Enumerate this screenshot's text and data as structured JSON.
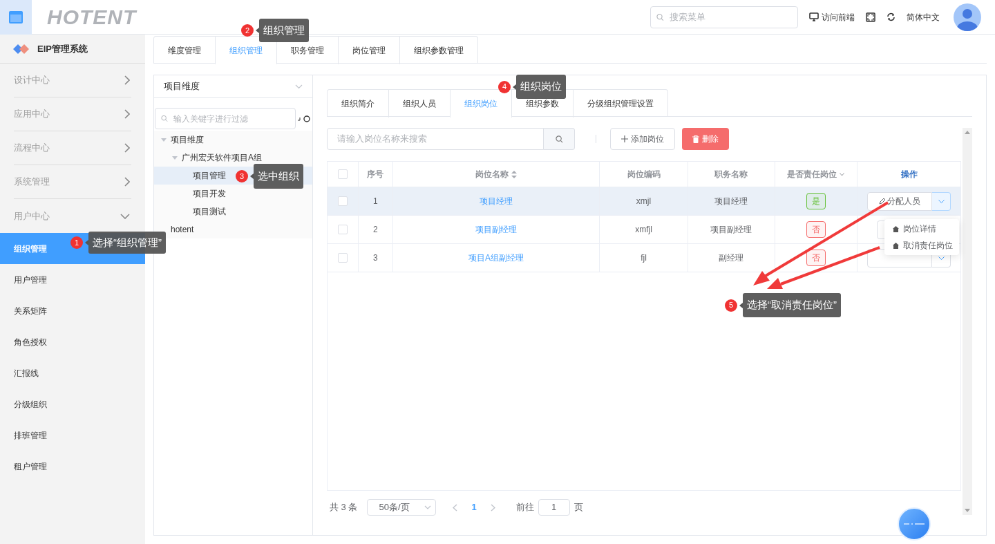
{
  "header": {
    "logo": "HOTENT",
    "search_placeholder": "搜索菜单",
    "visit_frontend": "访问前端",
    "language": "简体中文"
  },
  "sidebar": {
    "title": "EIP管理系统",
    "groups": [
      {
        "label": "设计中心",
        "expanded": false
      },
      {
        "label": "应用中心",
        "expanded": false
      },
      {
        "label": "流程中心",
        "expanded": false
      },
      {
        "label": "系统管理",
        "expanded": false
      },
      {
        "label": "用户中心",
        "expanded": true,
        "children": [
          {
            "label": "组织管理",
            "selected": true
          },
          {
            "label": "用户管理",
            "selected": false
          },
          {
            "label": "关系矩阵",
            "selected": false
          },
          {
            "label": "角色授权",
            "selected": false
          },
          {
            "label": "汇报线",
            "selected": false
          },
          {
            "label": "分级组织",
            "selected": false
          },
          {
            "label": "排班管理",
            "selected": false
          },
          {
            "label": "租户管理",
            "selected": false
          }
        ]
      }
    ]
  },
  "top_tabs": [
    {
      "label": "维度管理",
      "selected": false
    },
    {
      "label": "组织管理",
      "selected": true
    },
    {
      "label": "职务管理",
      "selected": false
    },
    {
      "label": "岗位管理",
      "selected": false
    },
    {
      "label": "组织参数管理",
      "selected": false
    }
  ],
  "tree_panel": {
    "dimension": "项目维度",
    "filter_placeholder": "输入关键字进行过滤",
    "tree": [
      {
        "label": "项目维度",
        "expanded": true,
        "selected": false,
        "children": [
          {
            "label": "广州宏天软件项目A组",
            "expanded": true,
            "selected": false,
            "children": [
              {
                "label": "项目管理",
                "selected": true
              },
              {
                "label": "项目开发",
                "selected": false
              },
              {
                "label": "项目测试",
                "selected": false
              }
            ]
          }
        ]
      },
      {
        "label": "hotent",
        "selected": false
      }
    ]
  },
  "inner_tabs": [
    {
      "label": "组织简介",
      "selected": false
    },
    {
      "label": "组织人员",
      "selected": false
    },
    {
      "label": "组织岗位",
      "selected": true
    },
    {
      "label": "组织参数",
      "selected": false
    },
    {
      "label": "分级组织管理设置",
      "selected": false
    }
  ],
  "toolbar": {
    "search_placeholder": "请输入岗位名称来搜索",
    "add_button": "添加岗位",
    "delete_button": "删除"
  },
  "table": {
    "all_checked": false,
    "columns": [
      "序号",
      "岗位名称",
      "岗位编码",
      "职务名称",
      "是否责任岗位",
      "操作"
    ],
    "rows": [
      {
        "selected": true,
        "checked": false,
        "index": "1",
        "name": "项目经理",
        "code": "xmjl",
        "job": "项目经理",
        "responsible": {
          "text": "是",
          "color": "#67c23a"
        },
        "action": "分配人员"
      },
      {
        "selected": false,
        "checked": false,
        "index": "2",
        "name": "项目副经理",
        "code": "xmfjl",
        "job": "项目副经理",
        "responsible": {
          "text": "否",
          "color": "#f56c6c"
        }
      },
      {
        "selected": false,
        "checked": false,
        "index": "3",
        "name": "项目A组副经理",
        "code": "fjl",
        "job": "副经理",
        "responsible": {
          "text": "否",
          "color": "#f56c6c"
        }
      }
    ]
  },
  "dropdown": {
    "items": [
      "岗位详情",
      "取消责任岗位"
    ]
  },
  "pagination": {
    "total": "共 3 条",
    "page_size": "50条/页",
    "current": "1",
    "goto_label": "前往",
    "goto_value": "1",
    "page_unit": "页"
  },
  "callouts": [
    {
      "number": "1",
      "text": "选择“组织管理”"
    },
    {
      "number": "2",
      "text": "组织管理"
    },
    {
      "number": "3",
      "text": "选中组织"
    },
    {
      "number": "4",
      "text": "组织岗位"
    },
    {
      "number": "5",
      "text": "选择“取消责任岗位”"
    }
  ]
}
